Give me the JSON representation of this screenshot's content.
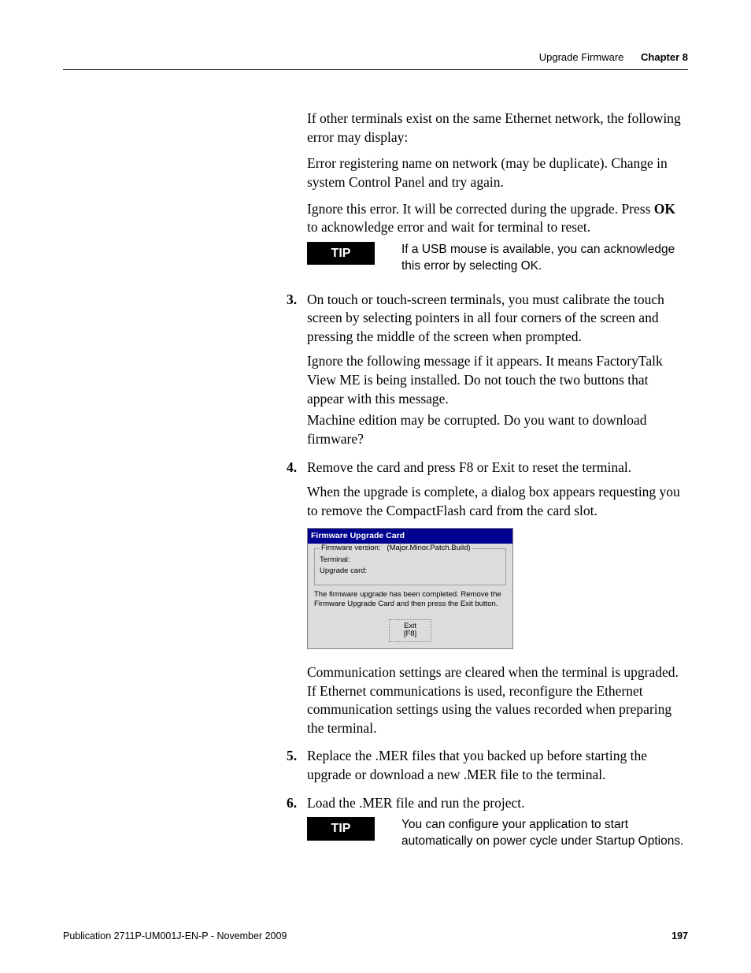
{
  "header": {
    "section": "Upgrade Firmware",
    "chapter": "Chapter 8"
  },
  "intro": {
    "p1": "If other terminals exist on the same Ethernet network, the following error may display:",
    "p2": "Error registering name on network (may be duplicate). Change in system Control Panel and try again.",
    "p3a": "Ignore this error. It will be corrected during the upgrade. Press ",
    "p3bold": "OK",
    "p3b": " to acknowledge error and wait for terminal to reset."
  },
  "tip1": {
    "label": "TIP",
    "text": "If a USB mouse is available, you can acknowledge this error by selecting OK."
  },
  "step3": {
    "lead": "On touch or touch-screen terminals, you must calibrate the touch screen by selecting pointers in all four corners of the screen and pressing the middle of the screen when prompted.",
    "body1": "Ignore the following message if it appears. It means FactoryTalk View ME is being installed. Do not touch the two buttons that appear with this message.",
    "body2": "Machine edition may be corrupted. Do you want to download firmware?"
  },
  "step4": {
    "lead": "Remove the card and press F8 or Exit to reset the terminal.",
    "body1": "When the upgrade is complete, a dialog box appears requesting you to remove the CompactFlash card from the card slot.",
    "after": "Communication settings are cleared when the terminal is upgraded. If Ethernet communications is used, reconfigure the Ethernet communication settings using the values recorded when preparing the terminal."
  },
  "dialog": {
    "title": "Firmware Upgrade Card",
    "group_legend_left": "Firmware version:",
    "group_legend_right": "(Major.Minor.Patch.Build)",
    "row_terminal_label": "Terminal:",
    "row_terminal_value": "",
    "row_card_label": "Upgrade card:",
    "row_card_value": "",
    "message": "The firmware upgrade has been completed. Remove the Firmware Upgrade Card and then press the Exit button.",
    "button_line1": "Exit",
    "button_line2": "[F8]"
  },
  "step5": {
    "lead": "Replace the .MER files that you backed up before starting the upgrade or download a new .MER file to the terminal."
  },
  "step6": {
    "lead": "Load the .MER file and run the project."
  },
  "tip2": {
    "label": "TIP",
    "text": "You can configure your application to start automatically on power cycle under Startup Options."
  },
  "footer": {
    "pub": "Publication 2711P-UM001J-EN-P - November 2009",
    "page": "197"
  }
}
